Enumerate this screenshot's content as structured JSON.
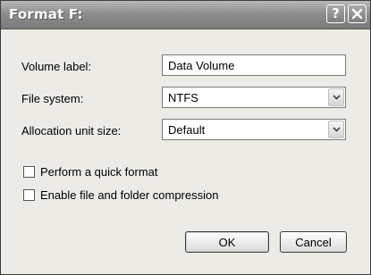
{
  "window": {
    "title": "Format F:",
    "help_glyph": "?",
    "help_icon": "help-icon",
    "close_icon": "close-icon"
  },
  "form": {
    "volume_label": {
      "label": "Volume label:",
      "value": "Data Volume"
    },
    "file_system": {
      "label": "File system:",
      "value": "NTFS",
      "icon": "chevron-down-icon"
    },
    "allocation_unit_size": {
      "label": "Allocation unit size:",
      "value": "Default",
      "icon": "chevron-down-icon"
    }
  },
  "options": {
    "quick_format": {
      "label": "Perform a quick format",
      "checked": false
    },
    "compression": {
      "label": "Enable file and folder compression",
      "checked": false
    }
  },
  "buttons": {
    "ok": "OK",
    "cancel": "Cancel"
  }
}
